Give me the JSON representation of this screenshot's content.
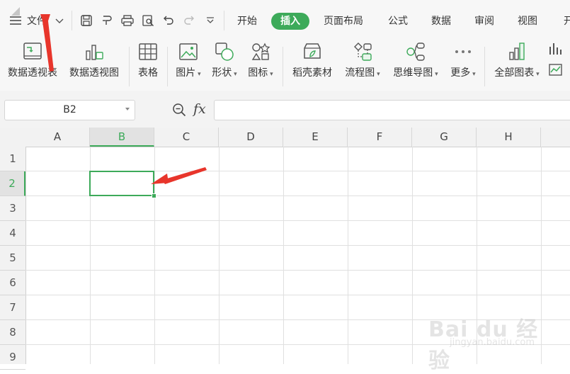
{
  "menu": {
    "file_label": "文件"
  },
  "tabs": [
    "开始",
    "插入",
    "页面布局",
    "公式",
    "数据",
    "审阅",
    "视图",
    "开"
  ],
  "active_tab": "插入",
  "accent_color": "#3daa5a",
  "annotation_color": "#e8352b",
  "ribbon": {
    "pivot_table": "数据透视表",
    "pivot_chart": "数据透视图",
    "table": "表格",
    "picture": "图片",
    "shape": "形状",
    "icon": "图标",
    "shell_material": "稻壳素材",
    "flowchart": "流程图",
    "mindmap": "思维导图",
    "more": "更多",
    "all_charts": "全部图表"
  },
  "formula_bar": {
    "name_box": "B2",
    "fx_label": "fx",
    "formula_value": ""
  },
  "sheet": {
    "columns": [
      "A",
      "B",
      "C",
      "D",
      "E",
      "F",
      "G",
      "H"
    ],
    "rows": [
      "1",
      "2",
      "3",
      "4",
      "5",
      "6",
      "7",
      "8",
      "9"
    ],
    "selected_cell": "B2"
  },
  "watermark": {
    "main": "Bai du 经验",
    "sub": "jingyan.baidu.com"
  }
}
